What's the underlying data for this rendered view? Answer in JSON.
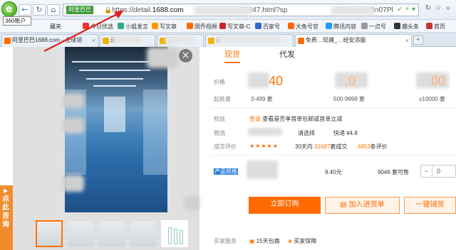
{
  "browser": {
    "tooltip": "360帐户",
    "url_prefix": "https://detail.",
    "url_domain": "1688.com",
    "url_mid": "77047.html?sp",
    "url_tail": "20n1mb.1.3n07Pl",
    "site_chip": "阿里巴巴",
    "bookmarks": [
      "藏夹",
      "今日优选",
      "小姐发言",
      "写文章",
      "国乔视频",
      "写文章-C",
      "百家号",
      "大鱼号官",
      "腾讯内容",
      "一点号",
      "趣头条",
      "首页"
    ],
    "tabs": [
      {
        "label": "阿里巴巴1688.com - 全球领",
        "active": false
      },
      {
        "label": "进",
        "active": false
      },
      {
        "label": "进",
        "active": false
      },
      {
        "label": "进",
        "active": false
      },
      {
        "label": "免费…现摸_…经安添服",
        "active": true
      }
    ],
    "new_tab": "+"
  },
  "page": {
    "side_float": "点此咨询",
    "close": "×",
    "tabs": [
      "现货",
      "代发"
    ],
    "price_label": "价格",
    "prices": [
      {
        "amount": "9.40",
        "min_qty": "3-499 套"
      },
      {
        "amount": "",
        "min_qty": "500-9999 套"
      },
      {
        "amount": "",
        "min_qty": "≥10000 套"
      }
    ],
    "moq_label": "起批量",
    "benefit_label": "权益",
    "benefit_tag": "登录",
    "benefit_text": "查看是否享首单包邮或首单立减",
    "logistics_label": "物流",
    "logistics_select": "请选择",
    "logistics_express": "快递 ¥4.8",
    "review_label": "成交评价",
    "stars": "★★★★★",
    "deals_prefix": "30天内",
    "deals_count": "31687",
    "deals_suffix": "套成交",
    "reviews_count": "4853",
    "reviews_suffix": "条评价",
    "spec_label": "产品规格",
    "spec_price": "9.40元",
    "spec_stock": "9046 套可售",
    "stepper_minus": "−",
    "stepper_value": "0",
    "buy_button": "立即订购",
    "cart_button": "加入进货单",
    "quick_button": "一键铺货",
    "service_label": "买家服务",
    "service_1": "15天包换",
    "service_2": "买家保障"
  },
  "colors": {
    "accent": "#ff6a00",
    "link_blue": "#2a7ddc",
    "arrow": "#e02020"
  }
}
